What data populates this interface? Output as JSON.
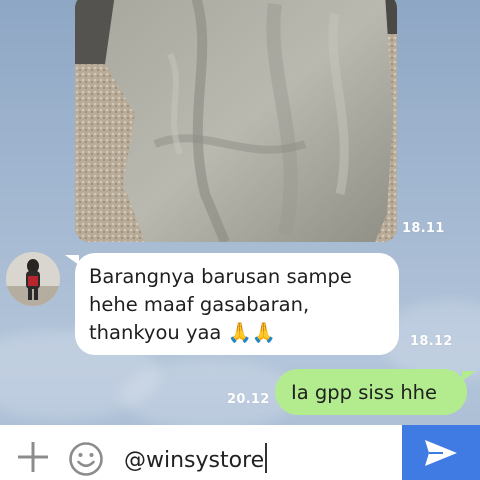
{
  "chat": {
    "photo_message": {
      "timestamp": "18.11"
    },
    "incoming_message": {
      "lines": [
        "Barangnya barusan sampe",
        "hehe maaf gasabaran,",
        "thankyou yaa 🙏🙏"
      ],
      "timestamp": "18.12"
    },
    "outgoing_message": {
      "text": "Ia gpp siss hhe",
      "timestamp": "20.12"
    }
  },
  "composer": {
    "input_value": "@winsystore",
    "plus_icon": "plus-icon",
    "emoji_icon": "smiley-icon",
    "send_icon": "send-icon"
  },
  "colors": {
    "outgoing_bubble": "#b3ec8e",
    "incoming_bubble": "#ffffff",
    "send_button": "#3f7be3",
    "background": "#a5b9d2"
  }
}
